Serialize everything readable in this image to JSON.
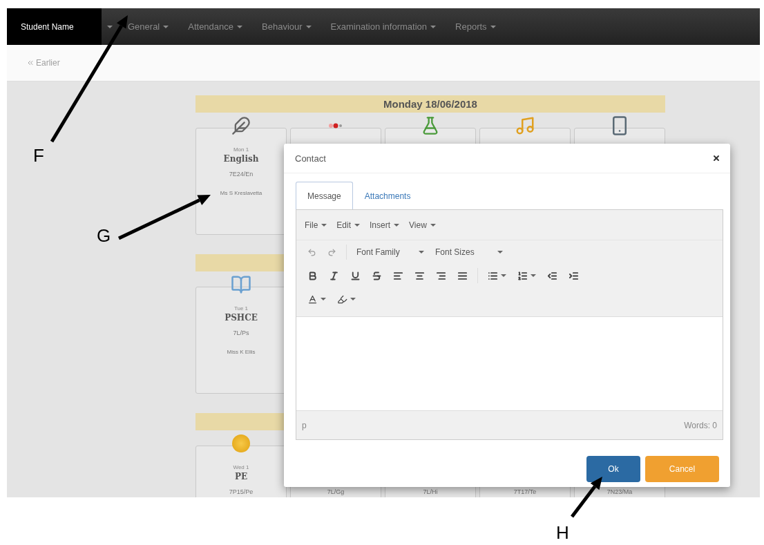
{
  "navbar": {
    "brand": "Student Name",
    "menus": [
      "General",
      "Attendance",
      "Behaviour",
      "Examination information",
      "Reports"
    ]
  },
  "subbar": {
    "back_link": "Earlier"
  },
  "timetable": {
    "days": [
      {
        "heading": "Monday 18/06/2018",
        "lessons": [
          {
            "period": "Mon 1",
            "subject": "English",
            "group": "7E24/En",
            "teacher": "Ms S Kreslavetta"
          }
        ]
      },
      {
        "lessons": [
          {
            "period": "Tue 1",
            "subject": "PSHCE",
            "group": "7L/Ps",
            "teacher": "Miss K Ellis"
          }
        ]
      },
      {
        "lessons": [
          {
            "period": "Wed 1",
            "subject": "PE",
            "group": "7P15/Pe"
          },
          {
            "group": "7L/Gg"
          },
          {
            "group": "7L/Hi"
          },
          {
            "group": "7T17/Te"
          },
          {
            "group": "7N23/Ma"
          }
        ]
      }
    ]
  },
  "dialog": {
    "title": "Contact",
    "tabs": [
      {
        "label": "Message",
        "selected": true
      },
      {
        "label": "Attachments",
        "selected": false
      }
    ],
    "editor": {
      "menus": [
        "File",
        "Edit",
        "Insert",
        "View"
      ],
      "font_family": "Font Family",
      "font_sizes": "Font Sizes",
      "path": "p",
      "word_count": "Words: 0"
    },
    "buttons": [
      {
        "label": "Ok",
        "kind": "primary"
      },
      {
        "label": "Cancel",
        "kind": "warning"
      }
    ]
  },
  "annotations": [
    {
      "label": "F"
    },
    {
      "label": "G"
    },
    {
      "label": "H"
    }
  ]
}
